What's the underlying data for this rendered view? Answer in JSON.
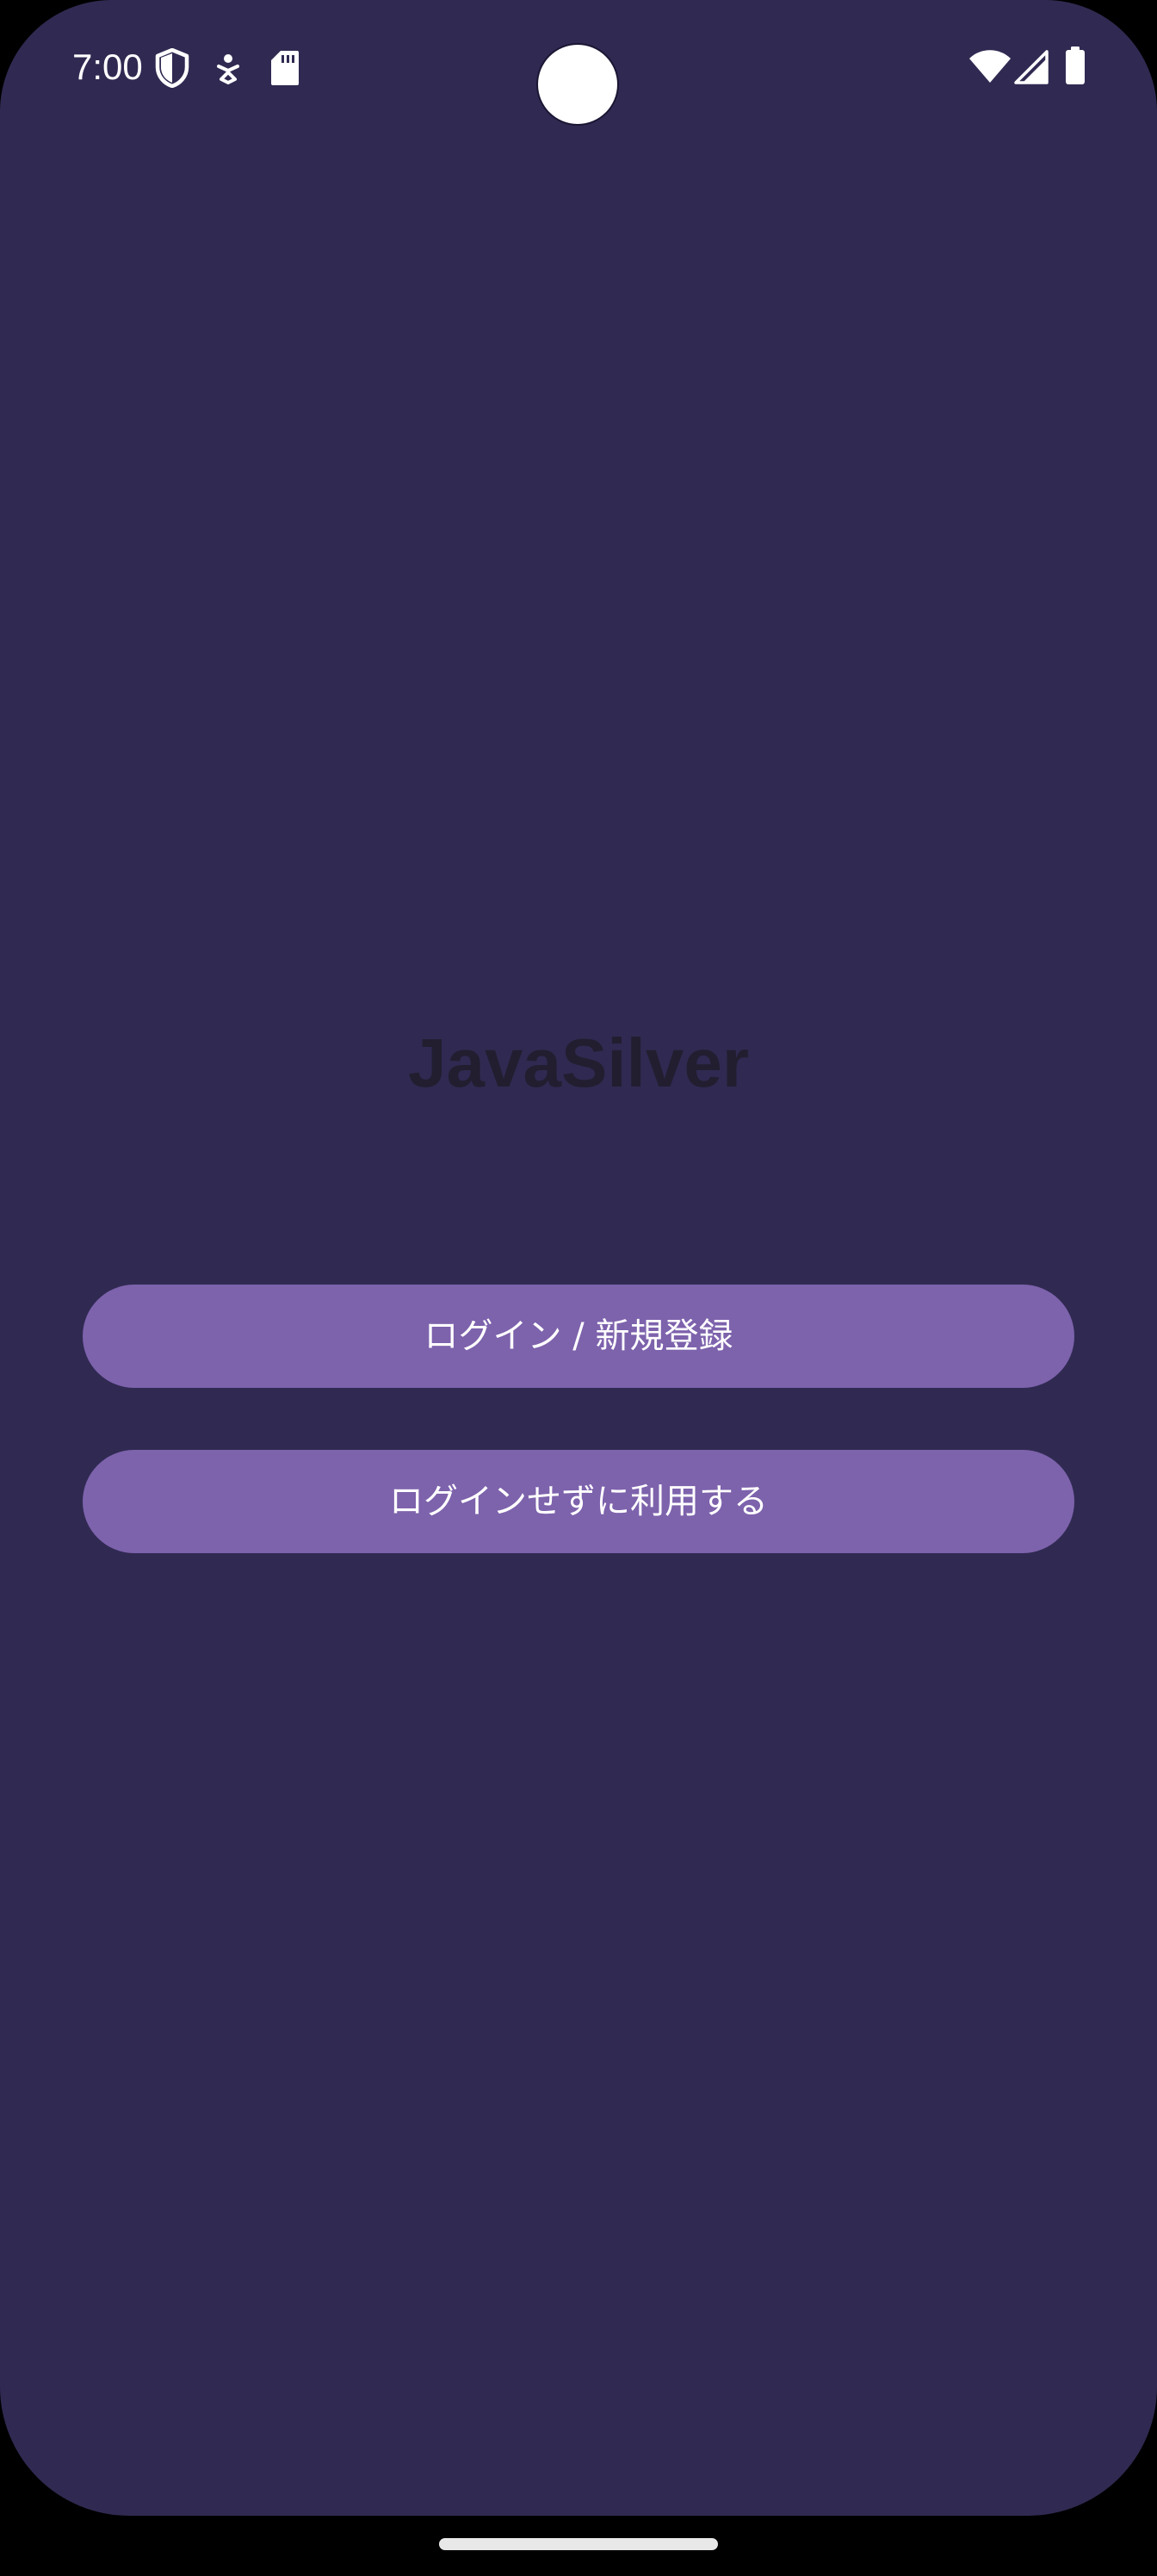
{
  "status_bar": {
    "time": "7:00",
    "left_icons": [
      "shield-icon",
      "accessibility-icon",
      "sd-card-icon"
    ],
    "right_icons": [
      "wifi-icon",
      "cellular-signal-icon",
      "battery-icon"
    ]
  },
  "app": {
    "title": "JavaSilver"
  },
  "buttons": {
    "login_label": "ログイン / 新規登録",
    "guest_label": "ログインせずに利用する"
  },
  "colors": {
    "background": "#302a52",
    "button": "#7d62ac",
    "title_text": "#221e30",
    "button_text": "#ffffff"
  }
}
